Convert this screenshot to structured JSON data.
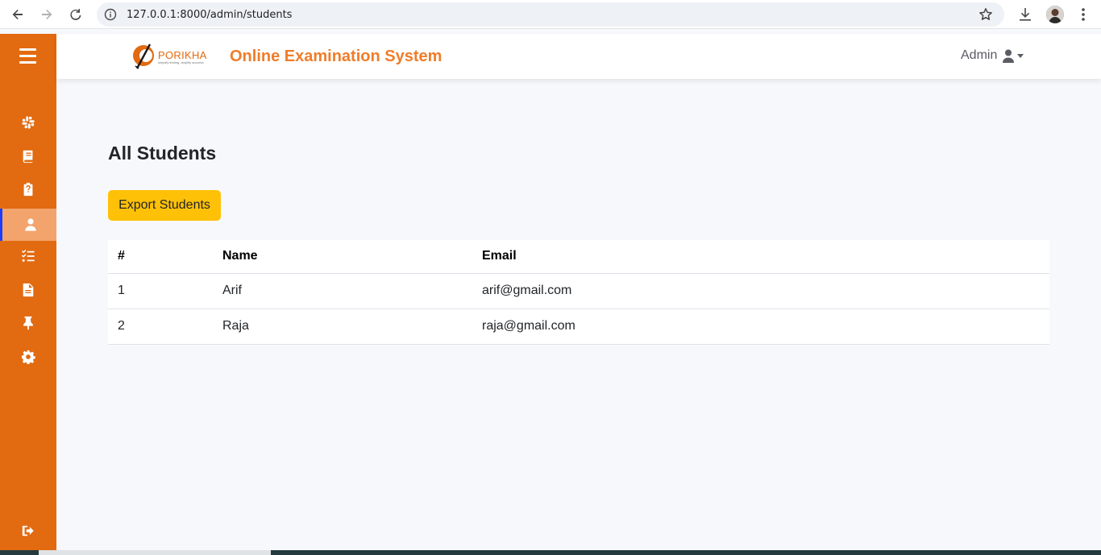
{
  "browser": {
    "url": "127.0.0.1:8000/admin/students"
  },
  "header": {
    "logo_text": "PORIKHA",
    "logo_tagline": "simplify testing, amplify success",
    "title": "Online Examination System",
    "user_label": "Admin"
  },
  "sidebar": {
    "items": [
      {
        "icon": "slack-icon"
      },
      {
        "icon": "book-icon"
      },
      {
        "icon": "clipboard-question-icon"
      },
      {
        "icon": "user-icon",
        "active": true
      },
      {
        "icon": "list-check-icon"
      },
      {
        "icon": "file-icon"
      },
      {
        "icon": "thumbtack-icon"
      },
      {
        "icon": "gear-icon"
      }
    ],
    "logout_icon": "sign-out-icon"
  },
  "main": {
    "title": "All Students",
    "export_label": "Export Students",
    "table": {
      "headers": [
        "#",
        "Name",
        "Email"
      ],
      "rows": [
        [
          "1",
          "Arif",
          "arif@gmail.com"
        ],
        [
          "2",
          "Raja",
          "raja@gmail.com"
        ]
      ]
    }
  },
  "colors": {
    "sidebar": "#e26a10",
    "active_item": "#f3a36c",
    "title_accent": "#ef7d2a",
    "button": "#ffc107"
  }
}
